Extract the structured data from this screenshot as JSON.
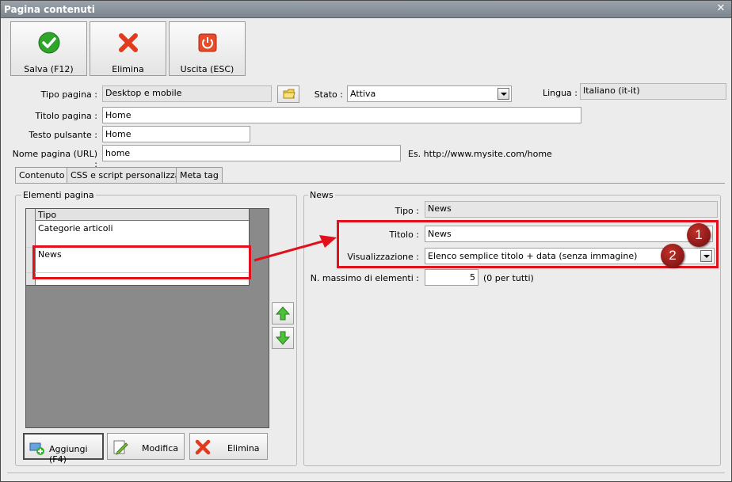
{
  "window": {
    "title": "Pagina contenuti"
  },
  "toolbar": {
    "save_label": "Salva (F12)",
    "delete_label": "Elimina",
    "exit_label": "Uscita (ESC)"
  },
  "form": {
    "tipo_pagina_label": "Tipo pagina :",
    "tipo_pagina_value": "Desktop e mobile",
    "stato_label": "Stato :",
    "stato_value": "Attiva",
    "lingua_label": "Lingua :",
    "lingua_value": "Italiano (it-it)",
    "titolo_pagina_label": "Titolo pagina :",
    "titolo_pagina_value": "Home",
    "testo_pulsante_label": "Testo pulsante :",
    "testo_pulsante_value": "Home",
    "nome_pagina_label": "Nome pagina (URL) :",
    "nome_pagina_value": "home",
    "url_example": "Es. http://www.mysite.com/home"
  },
  "tabs": [
    {
      "label": "Contenuto"
    },
    {
      "label": "CSS e script personalizzati"
    },
    {
      "label": "Meta tag"
    }
  ],
  "elements_panel": {
    "title": "Elementi pagina",
    "column_header": "Tipo",
    "rows": [
      "Categorie articoli",
      "News"
    ],
    "add_label": "Aggiungi (F4)",
    "edit_label": "Modifica",
    "delete_label": "Elimina"
  },
  "news_panel": {
    "title": "News",
    "tipo_label": "Tipo :",
    "tipo_value": "News",
    "titolo_label": "Titolo :",
    "titolo_value": "News",
    "visualizzazione_label": "Visualizzazione :",
    "visualizzazione_value": "Elenco semplice titolo + data (senza immagine)",
    "max_label": "N. massimo di elementi :",
    "max_value": "5",
    "max_hint": "(0 per tutti)"
  },
  "annotations": {
    "badge1": "1",
    "badge2": "2"
  },
  "colors": {
    "highlight_red": "#e2101a",
    "badge": "#8b1a16"
  }
}
